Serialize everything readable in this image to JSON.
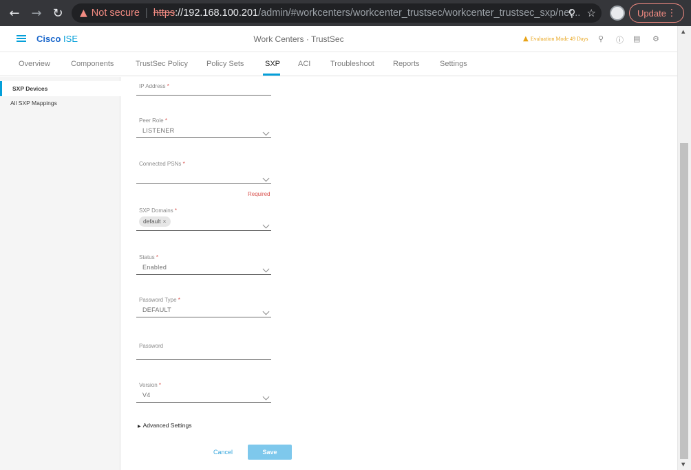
{
  "browser": {
    "not_secure": "Not secure",
    "scheme": "https",
    "host": "://192.168.100.201",
    "path": "/admin/#workcenters/workcenter_trustsec/workcenter_trustsec_sxp/net...",
    "update_label": "Update"
  },
  "header": {
    "brand_bold": "Cisco",
    "brand_light": "ISE",
    "title": "Work Centers · TrustSec",
    "evaluation": "Evaluation Mode 49 Days"
  },
  "tabs": [
    {
      "label": "Overview"
    },
    {
      "label": "Components"
    },
    {
      "label": "TrustSec Policy"
    },
    {
      "label": "Policy Sets"
    },
    {
      "label": "SXP",
      "active": true
    },
    {
      "label": "ACI"
    },
    {
      "label": "Troubleshoot"
    },
    {
      "label": "Reports"
    },
    {
      "label": "Settings"
    }
  ],
  "sidebar": {
    "items": [
      {
        "label": "SXP Devices",
        "active": true
      },
      {
        "label": "All SXP Mappings"
      }
    ]
  },
  "form": {
    "ip_address": {
      "label": "IP Address",
      "required": "*",
      "value": ""
    },
    "peer_role": {
      "label": "Peer Role",
      "required": "*",
      "value": "LISTENER"
    },
    "connected_psns": {
      "label": "Connected PSNs",
      "required": "*",
      "value": "",
      "error": "Required"
    },
    "sxp_domains": {
      "label": "SXP Domains",
      "required": "*",
      "chips": [
        "default"
      ],
      "chip_remove": "×"
    },
    "status": {
      "label": "Status",
      "required": "*",
      "value": "Enabled"
    },
    "password_type": {
      "label": "Password Type",
      "required": "*",
      "value": "DEFAULT"
    },
    "password": {
      "label": "Password",
      "value": ""
    },
    "version": {
      "label": "Version",
      "required": "*",
      "value": "V4"
    },
    "advanced_settings": "Advanced Settings",
    "cancel_label": "Cancel",
    "save_label": "Save"
  },
  "colors": {
    "accent": "#049fd9",
    "error": "#d9534f",
    "warning": "#e8a317",
    "save_button": "#7ec8ec"
  },
  "icons": {
    "browser": [
      "back-arrow-icon",
      "forward-arrow-icon",
      "reload-icon",
      "warning-icon",
      "zoom-icon",
      "star-icon",
      "profile-avatar-icon",
      "more-vert-icon"
    ],
    "header": [
      "hamburger-menu-icon",
      "warning-icon",
      "search-icon",
      "help-icon",
      "dashboard-icon",
      "gear-icon"
    ]
  }
}
